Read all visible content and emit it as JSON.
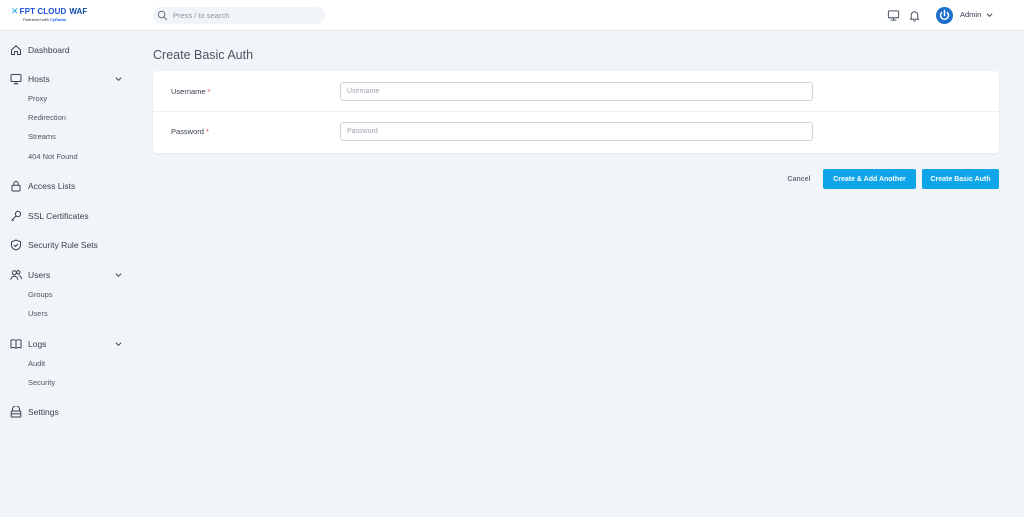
{
  "brand": {
    "name": "FPT CLOUD",
    "product": "WAF",
    "tagline_prefix": "Partnered with",
    "tagline_partner": "CyRadar"
  },
  "search": {
    "placeholder": "Press / to search"
  },
  "user": {
    "name": "Admin"
  },
  "sidebar": {
    "dashboard": "Dashboard",
    "hosts": {
      "label": "Hosts",
      "items": [
        "Proxy",
        "Redirection",
        "Streams",
        "404 Not Found"
      ]
    },
    "access_lists": "Access Lists",
    "ssl_certificates": "SSL Certificates",
    "security_rule_sets": "Security Rule Sets",
    "users": {
      "label": "Users",
      "items": [
        "Groups",
        "Users"
      ]
    },
    "logs": {
      "label": "Logs",
      "items": [
        "Audit",
        "Security"
      ]
    },
    "settings": "Settings"
  },
  "page": {
    "title": "Create Basic Auth"
  },
  "form": {
    "username": {
      "label": "Username",
      "required_mark": "*",
      "placeholder": "Username",
      "value": ""
    },
    "password": {
      "label": "Password",
      "required_mark": "*",
      "placeholder": "Password",
      "value": ""
    }
  },
  "actions": {
    "cancel": "Cancel",
    "create_add_another": "Create & Add Another",
    "create": "Create Basic Auth"
  },
  "colors": {
    "accent": "#0ea5e9",
    "brand_blue": "#1d4ed8",
    "required": "#ef4444",
    "background": "#f1f4f8"
  }
}
